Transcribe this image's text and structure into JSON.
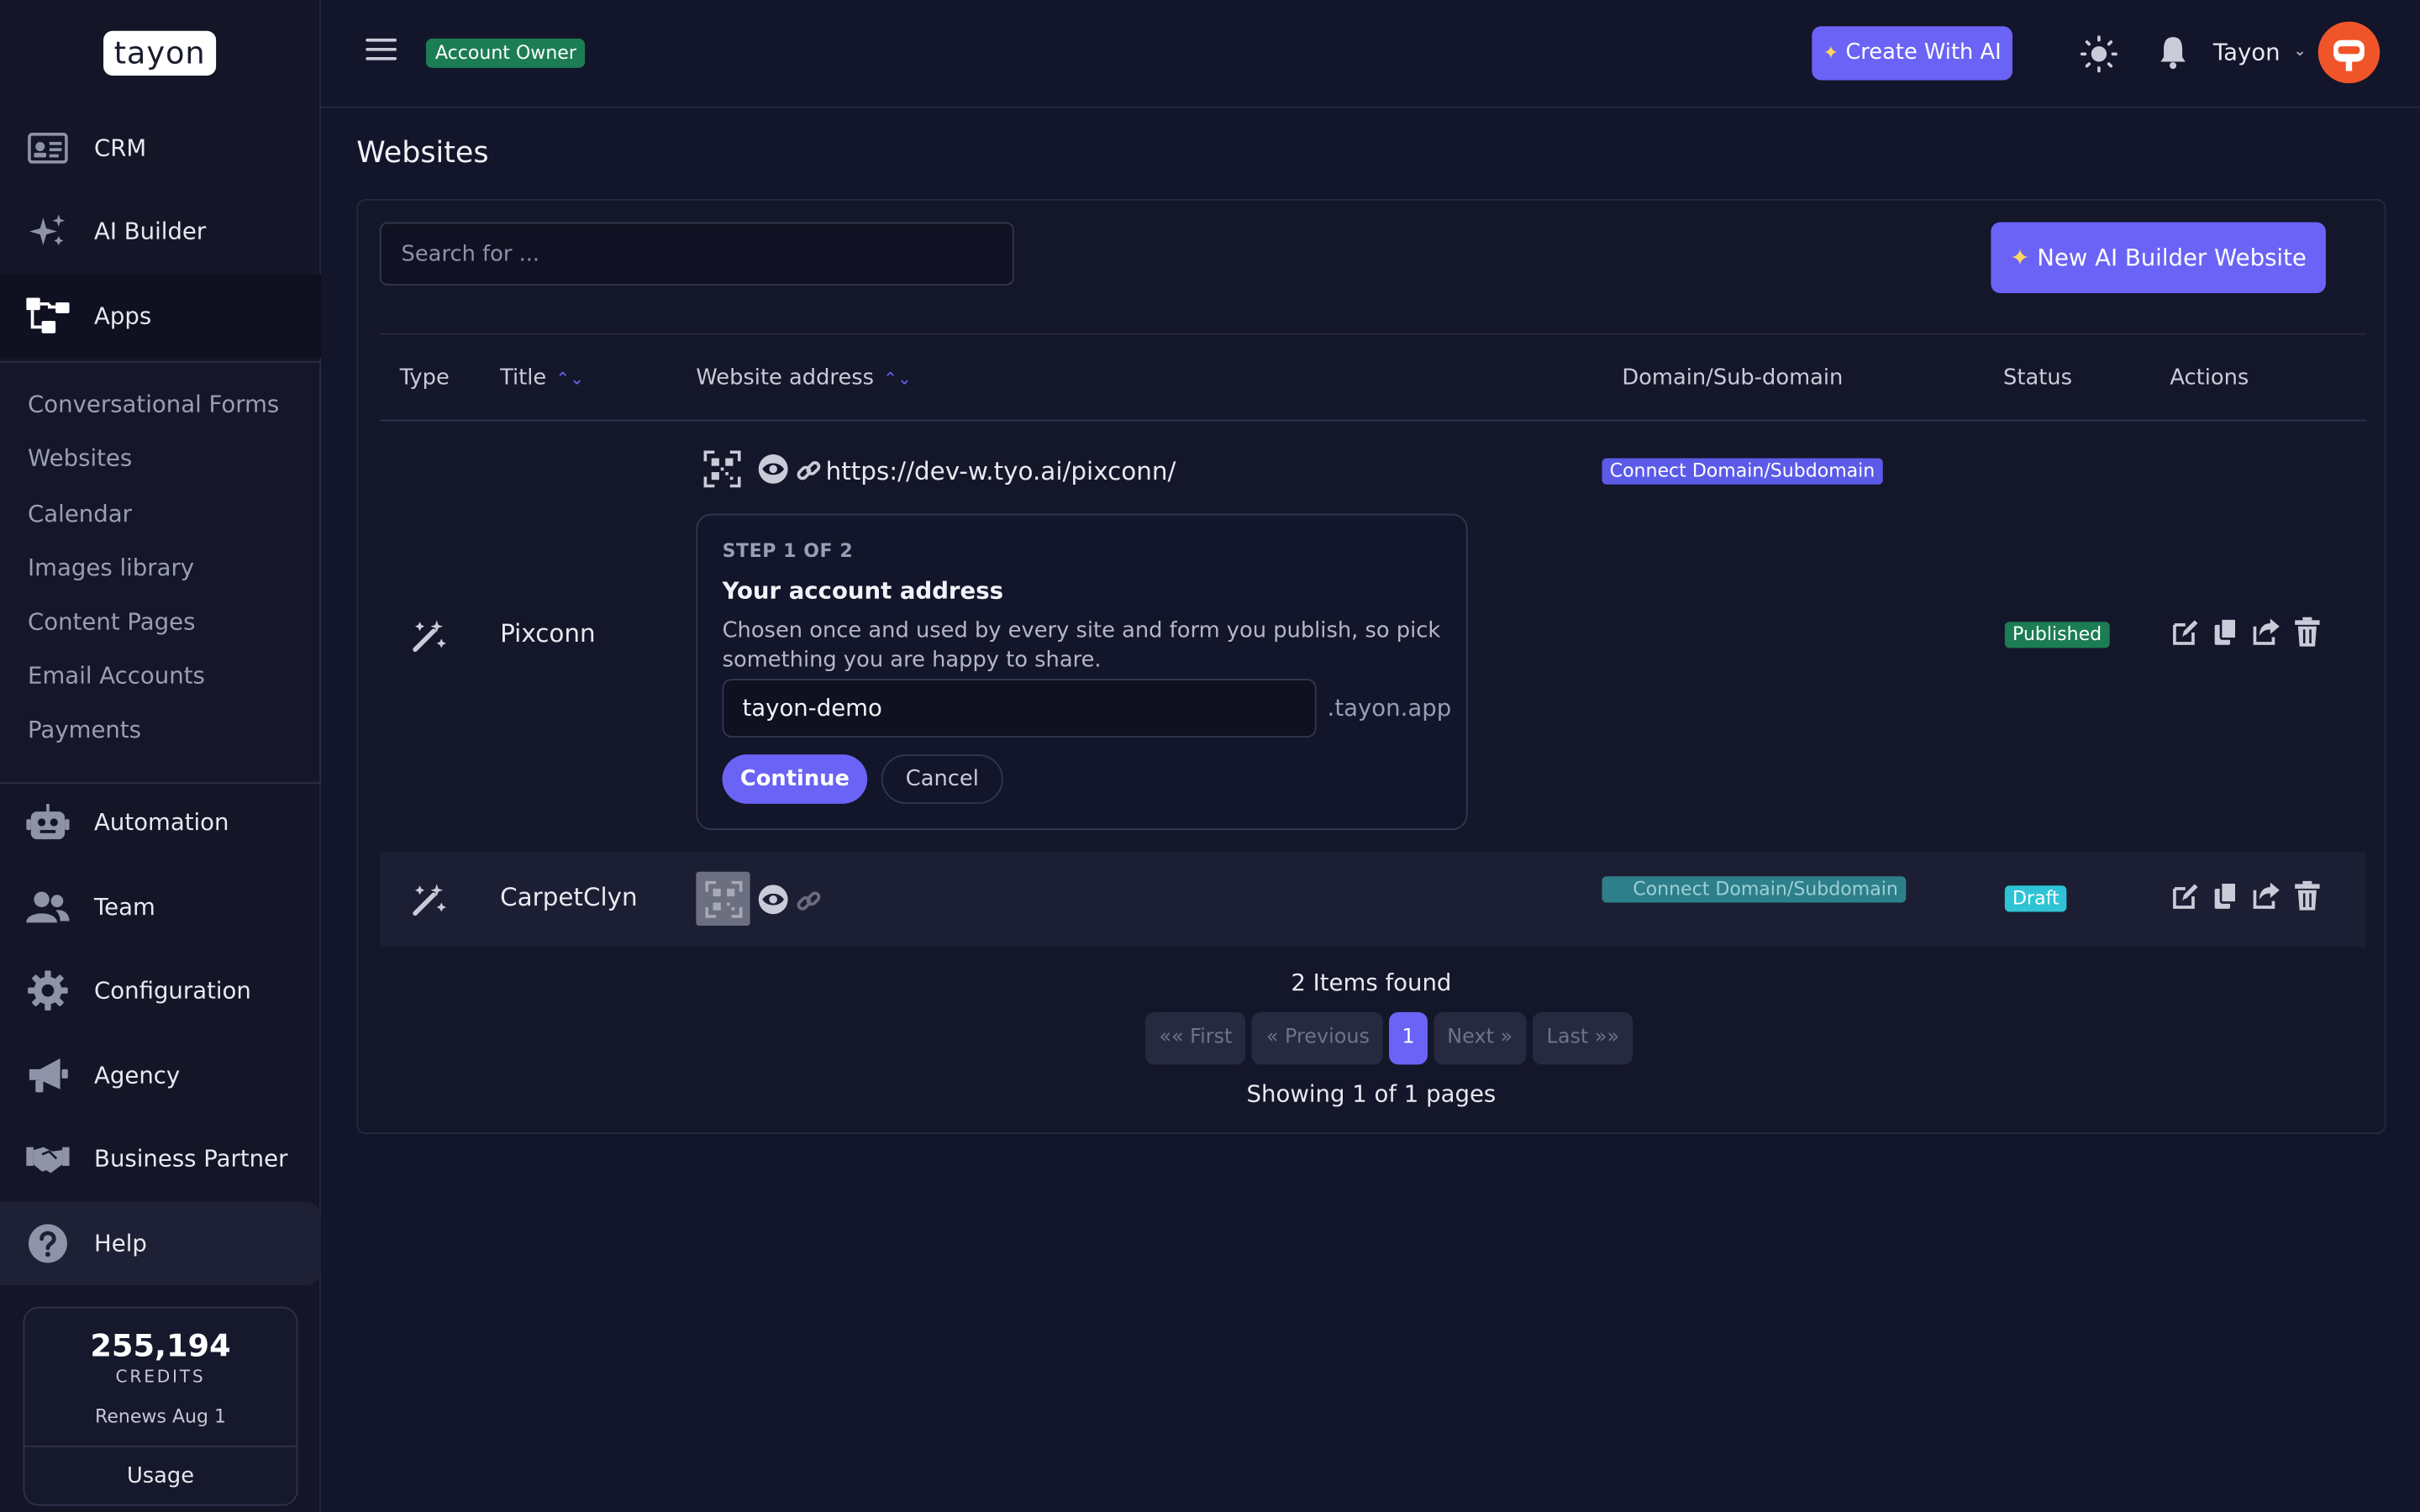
{
  "brand": {
    "logo_text": "tayon"
  },
  "sidebar": {
    "items": [
      {
        "label": "CRM",
        "icon": "id-card-icon"
      },
      {
        "label": "AI Builder",
        "icon": "sparkles-icon"
      },
      {
        "label": "Apps",
        "icon": "sitemap-icon",
        "active": true
      },
      {
        "label": "Automation",
        "icon": "robot-icon"
      },
      {
        "label": "Team",
        "icon": "users-icon"
      },
      {
        "label": "Configuration",
        "icon": "gear-icon"
      },
      {
        "label": "Agency",
        "icon": "megaphone-icon"
      },
      {
        "label": "Business Partner",
        "icon": "handshake-icon"
      },
      {
        "label": "Help",
        "icon": "question-circle-icon"
      }
    ],
    "apps_submenu": [
      "Conversational Forms",
      "Websites",
      "Calendar",
      "Images library",
      "Content Pages",
      "Email Accounts",
      "Payments"
    ],
    "credits": {
      "amount": "255,194",
      "label": "CREDITS",
      "renews": "Renews Aug 1",
      "usage_label": "Usage"
    }
  },
  "header": {
    "role_badge": "Account Owner",
    "create_ai_label": "Create With AI",
    "user_name": "Tayon",
    "colors": {
      "accent": "#6a63f5",
      "badge_green": "#1c7c54",
      "avatar": "#f0552a"
    }
  },
  "main": {
    "title": "Websites",
    "search_placeholder": "Search for ...",
    "new_button_label": "New AI Builder Website",
    "columns": [
      "Type",
      "Title",
      "Website address",
      "Domain/Sub-domain",
      "Status",
      "Actions"
    ],
    "rows": [
      {
        "title": "Pixconn",
        "url": "https://dev-w.tyo.ai/pixconn/",
        "domain_action": "Connect Domain/Subdomain",
        "status": "Published"
      },
      {
        "title": "CarpetClyn",
        "url": "",
        "domain_action": "Connect Domain/Subdomain",
        "status": "Draft"
      }
    ],
    "wizard": {
      "step": "STEP 1 OF 2",
      "title": "Your account address",
      "description": "Chosen once and used by every site and form you publish, so pick something you are happy to share.",
      "value": "tayon-demo",
      "suffix": ".tayon.app",
      "continue_label": "Continue",
      "cancel_label": "Cancel"
    },
    "items_found": "2 Items found",
    "pagination": {
      "first": "«« First",
      "previous": "« Previous",
      "current": "1",
      "next": "Next »",
      "last": "Last »»"
    },
    "showing": "Showing 1 of 1 pages"
  }
}
